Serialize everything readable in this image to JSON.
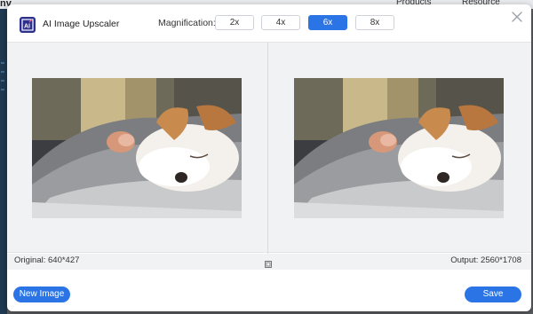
{
  "background": {
    "logo_text": "nv",
    "nav": [
      "Products",
      "Resource"
    ]
  },
  "dialog": {
    "title": "AI Image Upscaler",
    "magnification_label": "Magnification:",
    "magnification_options": [
      "2x",
      "4x",
      "6x",
      "8x"
    ],
    "selected_magnification": "6x",
    "original_info": "Original: 640*427",
    "output_info": "Output: 2560*1708",
    "new_image_label": "New Image",
    "save_label": "Save",
    "accent_color": "#2b74e6"
  }
}
